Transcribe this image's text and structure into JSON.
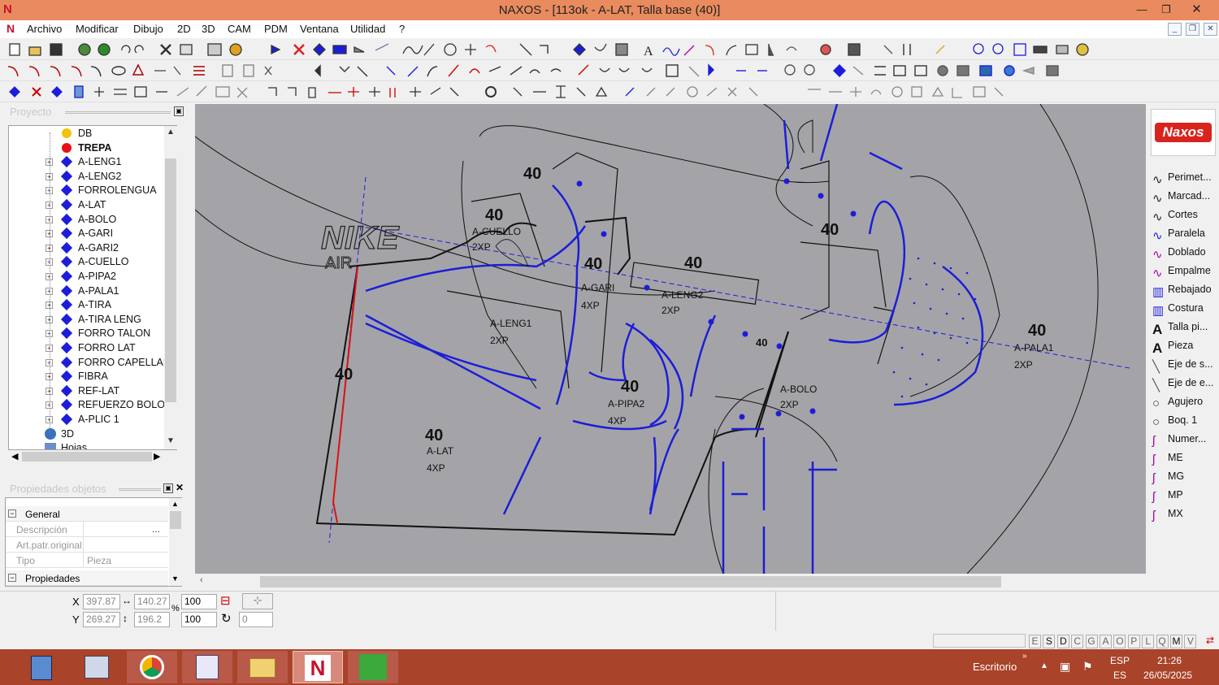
{
  "window": {
    "title": "NAXOS - [113ok - A-LAT, Talla base (40)]",
    "min": "—",
    "restore": "❐",
    "close": "✕",
    "app_letter": "N"
  },
  "menu": {
    "items": [
      "Archivo",
      "Modificar",
      "Dibujo",
      "2D",
      "3D",
      "CAM",
      "PDM",
      "Ventana",
      "Utilidad",
      "?"
    ],
    "mdi": [
      "_",
      "❐",
      "✕"
    ]
  },
  "project_panel": {
    "title": "Proyecto",
    "tree": [
      {
        "label": "DB",
        "icon": "yellow-circle"
      },
      {
        "label": "TREPA",
        "icon": "red-circle",
        "bold": true
      },
      {
        "label": "A-LENG1"
      },
      {
        "label": "A-LENG2"
      },
      {
        "label": "FORROLENGUA"
      },
      {
        "label": "A-LAT"
      },
      {
        "label": "A-BOLO"
      },
      {
        "label": "A-GARI"
      },
      {
        "label": "A-GARI2"
      },
      {
        "label": "A-CUELLO"
      },
      {
        "label": "A-PIPA2"
      },
      {
        "label": "A-PALA1"
      },
      {
        "label": "A-TIRA"
      },
      {
        "label": "A-TIRA LENG"
      },
      {
        "label": "FORRO TALON"
      },
      {
        "label": "FORRO LAT"
      },
      {
        "label": "FORRO CAPELLAD."
      },
      {
        "label": "FIBRA"
      },
      {
        "label": "REF-LAT"
      },
      {
        "label": "REFUERZO BOLO"
      },
      {
        "label": "A-PLIC 1"
      },
      {
        "label": "3D",
        "icon": "globe"
      },
      {
        "label": "Hojas",
        "icon": "sheets"
      }
    ]
  },
  "props_panel": {
    "title": "Propiedades objetos",
    "group_general": "General",
    "group_props": "Propiedades",
    "rows": [
      {
        "name": "Descripción",
        "value": "",
        "button": "..."
      },
      {
        "name": "Art.patr.original",
        "value": ""
      },
      {
        "name": "Tipo",
        "value": "Pieza"
      }
    ]
  },
  "canvas": {
    "pieces": [
      {
        "size": "40",
        "name": "A-CUELLO",
        "qty": "2XP"
      },
      {
        "size": "40",
        "name": "A-LENG1",
        "qty": "2XP"
      },
      {
        "size": "40",
        "name": "A-GARI",
        "qty": "4XP"
      },
      {
        "size": "40",
        "name": "A-LENG2",
        "qty": "2XP"
      },
      {
        "size": "40",
        "name": "A-PIPA2",
        "qty": "4XP"
      },
      {
        "size": "40",
        "name": "A-LAT",
        "qty": "4XP"
      },
      {
        "size": "40",
        "name": "A-BOLO",
        "qty": "2XP"
      },
      {
        "size": "40",
        "name": "A-PALA1",
        "qty": "2XP"
      },
      {
        "size": "40",
        "name": "",
        "qty": ""
      },
      {
        "size": "40",
        "name": "",
        "qty": ""
      },
      {
        "size": "40",
        "name": "",
        "qty": ""
      }
    ],
    "logo_text": "NIKE",
    "logo_sub": "AIR"
  },
  "right_panel": {
    "logo": "Naxos",
    "items": [
      "Perimet...",
      "Marcad...",
      "Cortes",
      "Paralela",
      "Doblado",
      "Empalme",
      "Rebajado",
      "Costura",
      "Talla pi...",
      "Pieza",
      "Eje de s...",
      "Eje de e...",
      "Agujero",
      "Boq. 1",
      "Numer...",
      "ME",
      "MG",
      "MP",
      "MX"
    ]
  },
  "coords": {
    "x_label": "X",
    "y_label": "Y",
    "x": "397.87",
    "y": "269.27",
    "w": "140.27",
    "h": "196.2",
    "sx": "100",
    "sy": "100",
    "angle": "0",
    "pct": "%"
  },
  "status_letters": [
    "E",
    "S",
    "D",
    "C",
    "G",
    "A",
    "O",
    "P",
    "L",
    "Q",
    "M",
    "V"
  ],
  "taskbar": {
    "desktop": "Escritorio",
    "lang1": "ESP",
    "lang2": "ES",
    "time": "21:26",
    "date": "26/05/2025"
  }
}
